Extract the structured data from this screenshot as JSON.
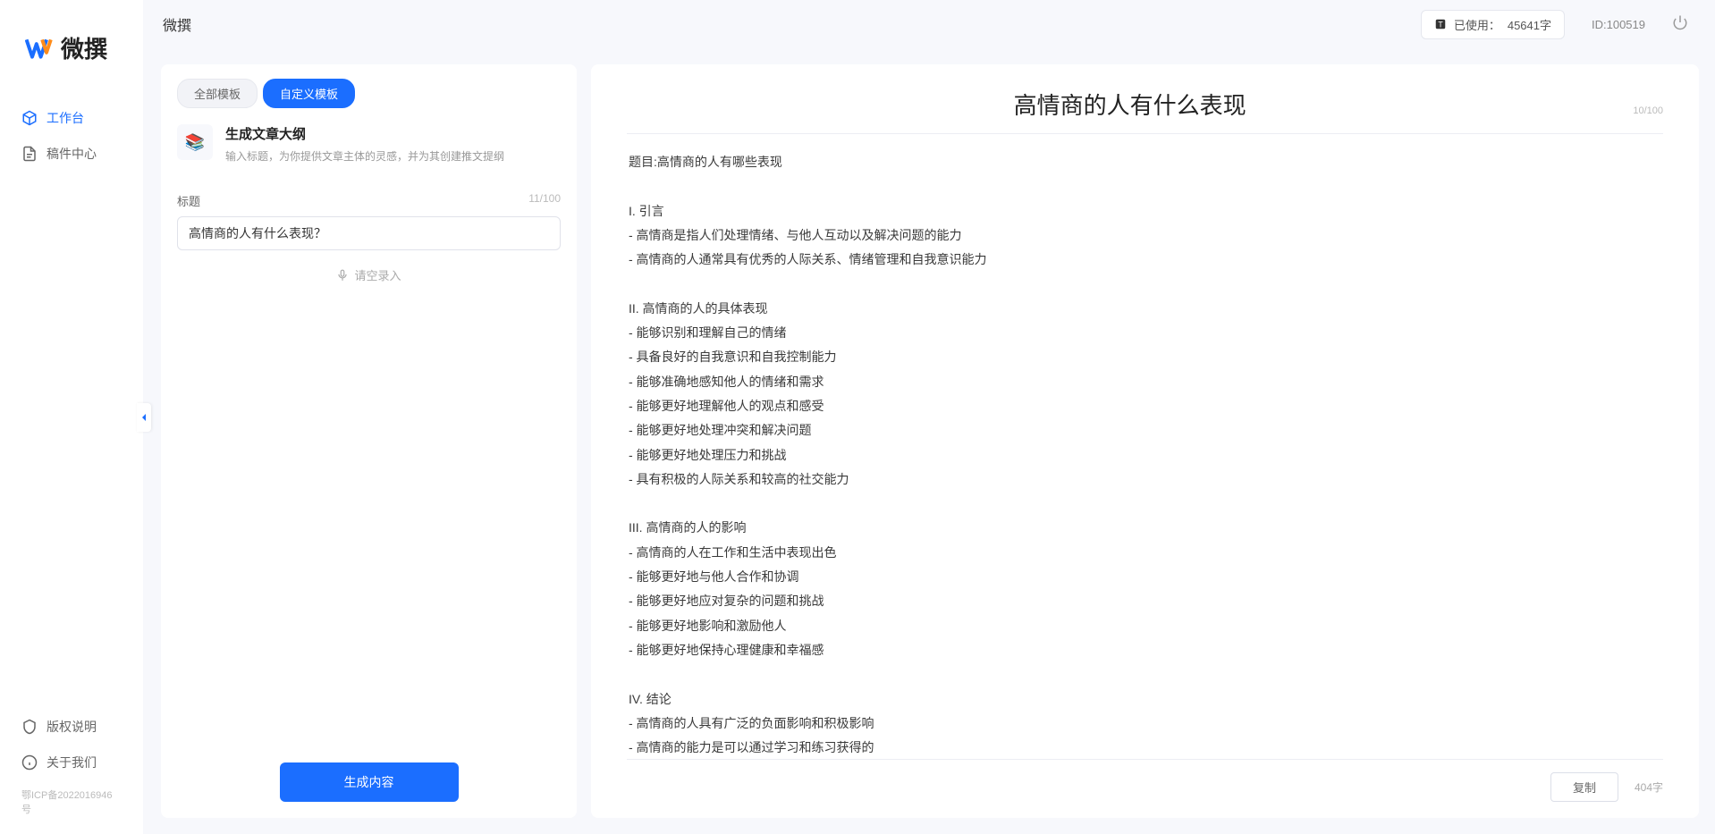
{
  "app": {
    "brand": "微撰",
    "title": "微撰"
  },
  "topbar": {
    "usage_label": "已使用：",
    "usage_value": "45641字",
    "user_id": "ID:100519"
  },
  "sidebar": {
    "nav": [
      {
        "key": "workbench",
        "label": "工作台",
        "active": true
      },
      {
        "key": "drafts",
        "label": "稿件中心",
        "active": false
      }
    ],
    "footer": [
      {
        "key": "copyright",
        "label": "版权说明"
      },
      {
        "key": "about",
        "label": "关于我们"
      }
    ],
    "icp": "鄂ICP备2022016946号"
  },
  "tabs": {
    "all": "全部模板",
    "custom": "自定义模板",
    "active": "custom"
  },
  "template": {
    "name": "生成文章大纲",
    "desc": "输入标题，为你提供文章主体的灵感，并为其创建推文提纲"
  },
  "form": {
    "title_label": "标题",
    "title_counter": "11/100",
    "title_value": "高情商的人有什么表现？",
    "voice_label": "请空录入",
    "generate_label": "生成内容"
  },
  "output": {
    "title": "高情商的人有什么表现",
    "title_counter": "10/100",
    "body": "题目:高情商的人有哪些表现\n\nI. 引言\n- 高情商是指人们处理情绪、与他人互动以及解决问题的能力\n- 高情商的人通常具有优秀的人际关系、情绪管理和自我意识能力\n\nII. 高情商的人的具体表现\n- 能够识别和理解自己的情绪\n- 具备良好的自我意识和自我控制能力\n- 能够准确地感知他人的情绪和需求\n- 能够更好地理解他人的观点和感受\n- 能够更好地处理冲突和解决问题\n- 能够更好地处理压力和挑战\n- 具有积极的人际关系和较高的社交能力\n\nIII. 高情商的人的影响\n- 高情商的人在工作和生活中表现出色\n- 能够更好地与他人合作和协调\n- 能够更好地应对复杂的问题和挑战\n- 能够更好地影响和激励他人\n- 能够更好地保持心理健康和幸福感\n\nIV. 结论\n- 高情商的人具有广泛的负面影响和积极影响\n- 高情商的能力是可以通过学习和练习获得的\n- 培养和提高高情商的能力对于个人的职业发展和生活质量至关重要。",
    "copy_label": "复制",
    "word_count": "404字"
  }
}
